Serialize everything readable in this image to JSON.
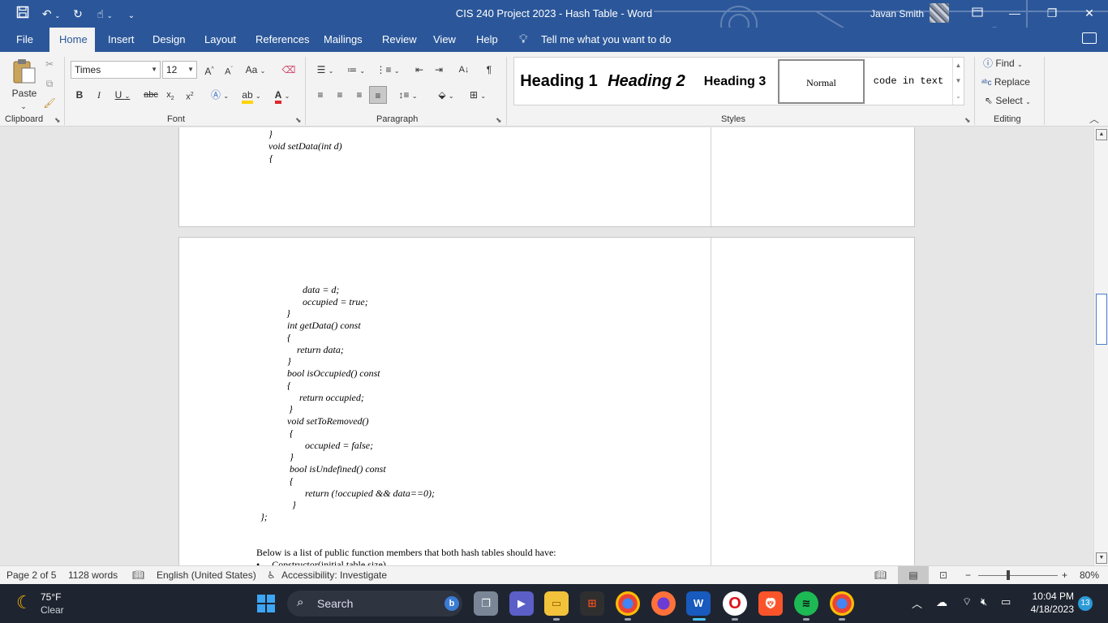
{
  "window": {
    "title": "CIS 240 Project 2023 - Hash Table  -  Word",
    "user_name": "Javan Smith"
  },
  "tabs": [
    "File",
    "Home",
    "Insert",
    "Design",
    "Layout",
    "References",
    "Mailings",
    "Review",
    "View",
    "Help"
  ],
  "tell_me": "Tell me what you want to do",
  "ribbon": {
    "clipboard": {
      "paste_label": "Paste",
      "group_label": "Clipboard"
    },
    "font": {
      "font_name": "Times",
      "font_size": "12",
      "group_label": "Font",
      "case_label": "Aa"
    },
    "paragraph": {
      "group_label": "Paragraph"
    },
    "styles": {
      "group_label": "Styles",
      "items": [
        "Heading 1",
        "Heading 2",
        "Heading 3",
        "Normal",
        "code in text"
      ],
      "selected": "Normal"
    },
    "editing": {
      "group_label": "Editing",
      "find": "Find",
      "replace": "Replace",
      "select": "Select"
    }
  },
  "document": {
    "page1_lines": [
      "}",
      "void setData(int d)",
      "{"
    ],
    "page2_code": [
      "data = d;",
      "occupied = true;",
      "}",
      "int getData() const",
      "{",
      "return data;",
      "}",
      "bool isOccupied() const",
      "{",
      "return occupied;",
      "}",
      "void setToRemoved()",
      "{",
      "occupied = false;",
      "}",
      "bool isUndefined() const",
      "{",
      "return (!occupied && data==0);",
      "}",
      "};"
    ],
    "paragraph": "Below is a list of public function members that both hash tables should have:",
    "bullet_partial": "Constructor(initial table size)"
  },
  "status": {
    "page": "Page 2 of 5",
    "words": "1128 words",
    "language": "English (United States)",
    "accessibility": "Accessibility: Investigate",
    "zoom": "80%"
  },
  "taskbar": {
    "weather_temp": "75°F",
    "weather_desc": "Clear",
    "search": "Search",
    "time": "10:04 PM",
    "date": "4/18/2023",
    "notifications": "13"
  },
  "colors": {
    "word_blue": "#2b579a",
    "taskbar": "#1f2530"
  }
}
